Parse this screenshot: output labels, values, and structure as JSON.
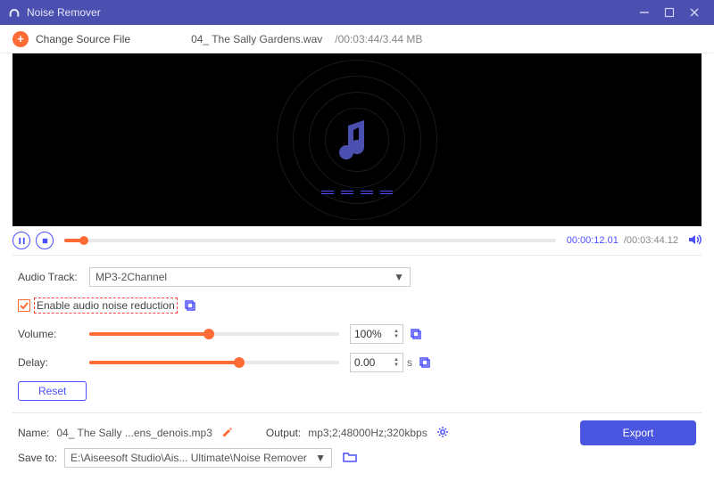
{
  "app": {
    "title": "Noise Remover"
  },
  "toolbar": {
    "change_source_label": "Change Source File",
    "filename": "04_ The Sally Gardens.wav",
    "fileinfo": "/00:03:44/3.44 MB"
  },
  "playback": {
    "time_current": "00:00:12.01",
    "time_total": "/00:03:44.12"
  },
  "audio_track": {
    "label": "Audio Track:",
    "value": "MP3-2Channel"
  },
  "noise_reduction": {
    "checked": true,
    "label": "Enable audio noise reduction"
  },
  "volume": {
    "label": "Volume:",
    "value": "100%",
    "percent": 48
  },
  "delay": {
    "label": "Delay:",
    "value": "0.00",
    "unit": "s",
    "percent": 60
  },
  "reset_label": "Reset",
  "output": {
    "name_label": "Name:",
    "name_value": "04_ The Sally ...ens_denois.mp3",
    "output_label": "Output:",
    "output_value": "mp3;2;48000Hz;320kbps"
  },
  "save": {
    "label": "Save to:",
    "path": "E:\\Aiseesoft Studio\\Ais... Ultimate\\Noise Remover"
  },
  "export_label": "Export"
}
